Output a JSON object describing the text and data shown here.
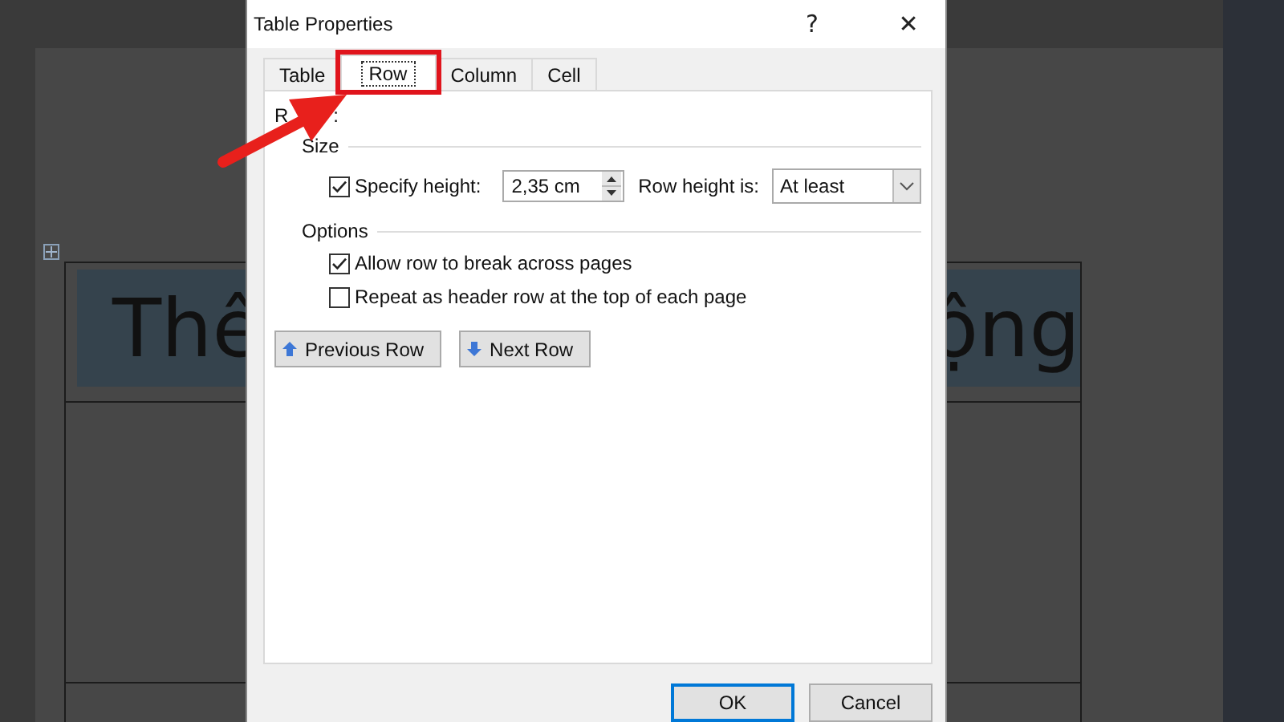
{
  "document": {
    "heading_fragments": [
      "Thê",
      "ộng"
    ]
  },
  "dialog": {
    "title": "Table Properties",
    "help": "?",
    "close": "✕",
    "tabs": [
      {
        "label": "Table",
        "selected": false,
        "highlighted": false
      },
      {
        "label": "Row",
        "selected": true,
        "highlighted": true
      },
      {
        "label": "Column",
        "selected": false,
        "highlighted": false
      },
      {
        "label": "Cell",
        "selected": false,
        "highlighted": false
      }
    ],
    "section_label_fragments": [
      "R",
      ":"
    ],
    "size_group": {
      "label": "Size",
      "specify_height": {
        "label": "Specify height:",
        "checked": true
      },
      "height_value": "2,35 cm",
      "height_rule_label": "Row height is:",
      "height_rule": "At least"
    },
    "options_group": {
      "label": "Options",
      "checkboxes": [
        {
          "label": "Allow row to break across pages",
          "checked": true
        },
        {
          "label": "Repeat as header row at the top of each page",
          "checked": false
        }
      ]
    },
    "nav_buttons": [
      {
        "label": "Previous Row",
        "kind": "up"
      },
      {
        "label": "Next Row",
        "kind": "down"
      }
    ],
    "buttons": [
      {
        "label": "OK",
        "default": true
      },
      {
        "label": "Cancel",
        "default": false
      }
    ]
  }
}
